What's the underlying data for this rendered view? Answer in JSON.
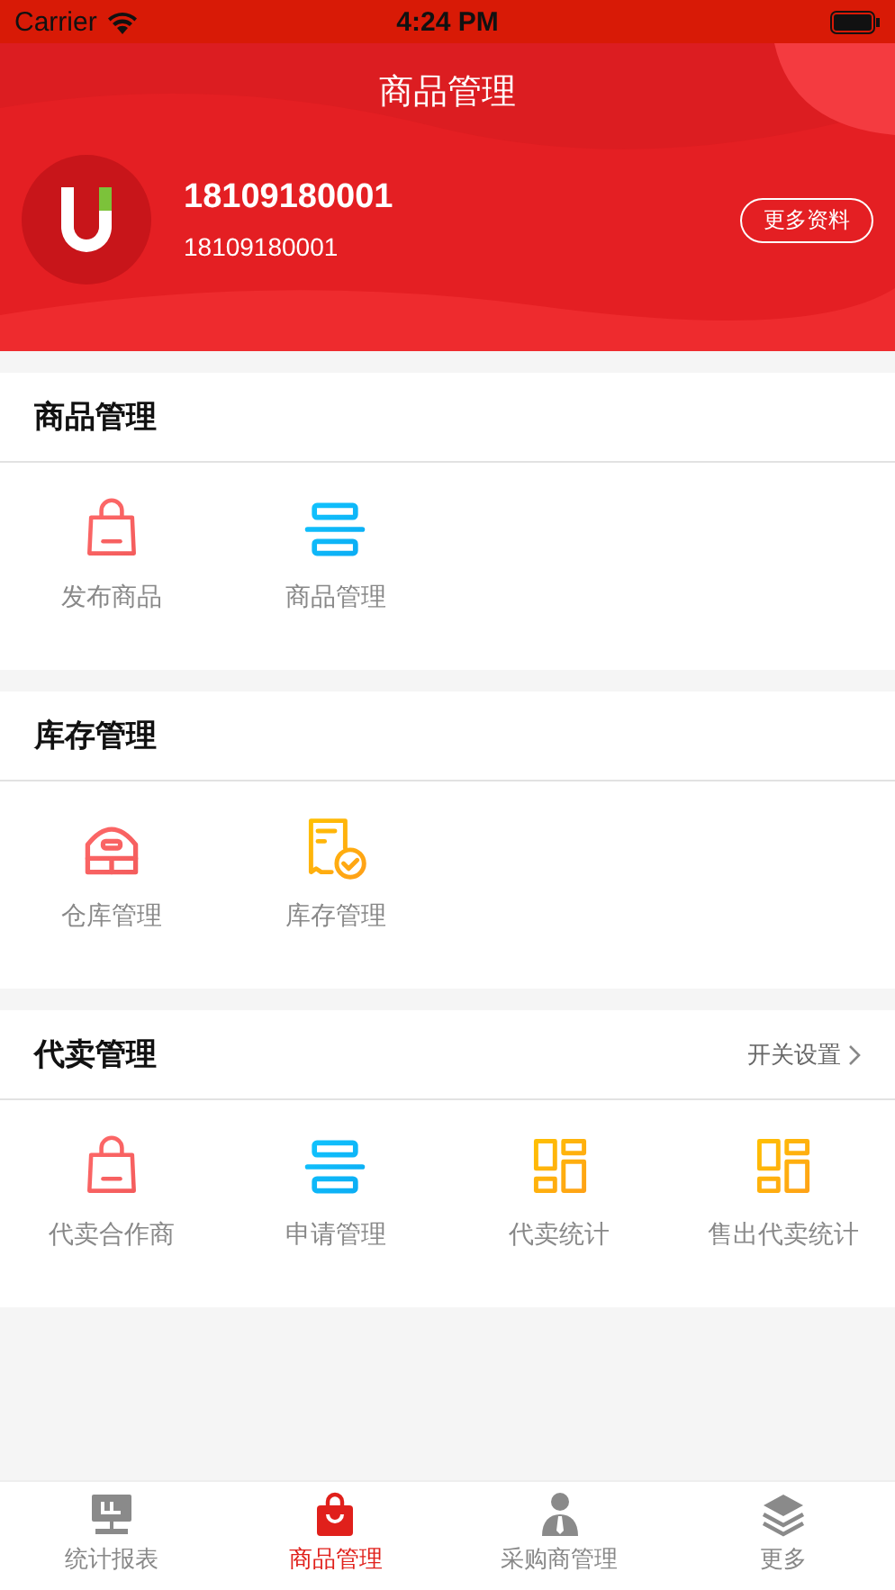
{
  "status_bar": {
    "carrier": "Carrier",
    "time": "4:24 PM"
  },
  "header": {
    "title": "商品管理",
    "name": "18109180001",
    "account": "18109180001",
    "more_button": "更多资料"
  },
  "sections": [
    {
      "title": "商品管理",
      "items": [
        {
          "kind": "bag",
          "label": "发布商品"
        },
        {
          "kind": "list",
          "label": "商品管理"
        }
      ]
    },
    {
      "title": "库存管理",
      "items": [
        {
          "kind": "warehouse",
          "label": "仓库管理"
        },
        {
          "kind": "report",
          "label": "库存管理"
        }
      ]
    },
    {
      "title": "代卖管理",
      "link": "开关设置",
      "items": [
        {
          "kind": "bag",
          "label": "代卖合作商"
        },
        {
          "kind": "list",
          "label": "申请管理"
        },
        {
          "kind": "grid",
          "label": "代卖统计"
        },
        {
          "kind": "grid",
          "label": "售出代卖统计"
        }
      ]
    }
  ],
  "tabs": [
    {
      "kind": "board",
      "label": "统计报表",
      "selected": false
    },
    {
      "kind": "bag",
      "label": "商品管理",
      "selected": true
    },
    {
      "kind": "person",
      "label": "采购商管理",
      "selected": false
    },
    {
      "kind": "layers",
      "label": "更多",
      "selected": false
    }
  ]
}
